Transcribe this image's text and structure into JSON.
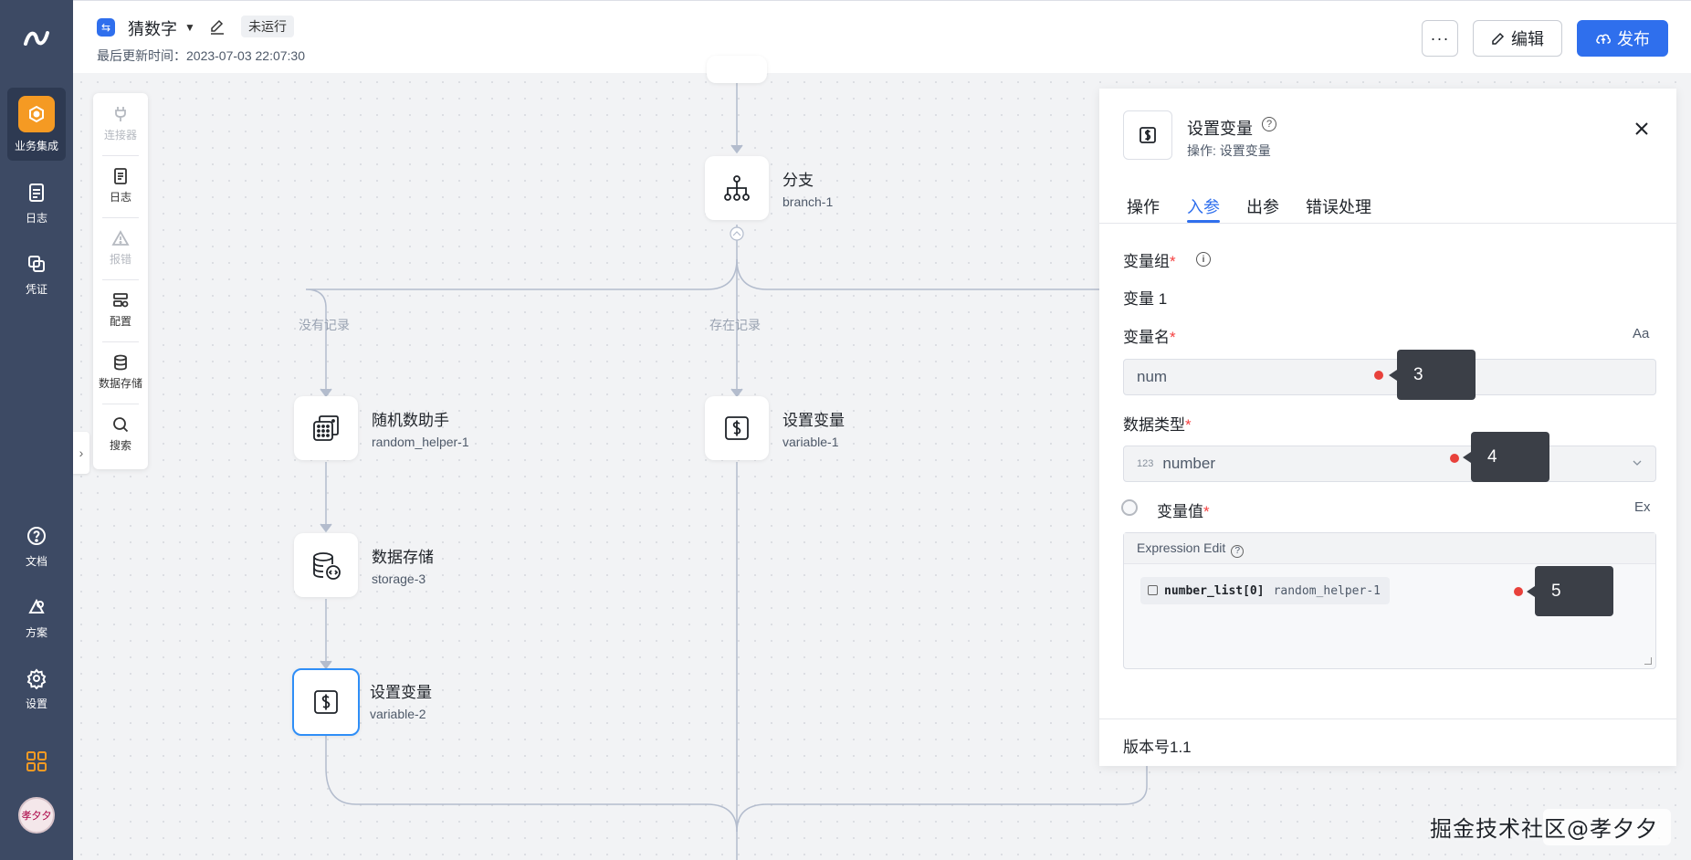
{
  "nav": {
    "items": [
      {
        "label": "业务集成",
        "icon": "integration-icon",
        "active": true
      },
      {
        "label": "日志",
        "icon": "log-icon"
      },
      {
        "label": "凭证",
        "icon": "credential-icon"
      },
      {
        "label": "文档",
        "icon": "help-icon"
      },
      {
        "label": "方案",
        "icon": "solution-icon"
      },
      {
        "label": "设置",
        "icon": "gear-icon"
      }
    ],
    "avatar_text": "孝夕夕"
  },
  "header": {
    "workflow_title": "猜数字",
    "status": "未运行",
    "updated_label": "最后更新时间：2023-07-03 22:07:30",
    "more_label": "···",
    "edit_label": "编辑",
    "publish_label": "发布"
  },
  "tools": [
    {
      "label": "连接器",
      "disabled": true
    },
    {
      "label": "日志",
      "disabled": false
    },
    {
      "label": "报错",
      "disabled": true
    },
    {
      "label": "配置",
      "disabled": false
    },
    {
      "label": "数据存储",
      "disabled": false
    },
    {
      "label": "搜索",
      "disabled": false
    }
  ],
  "flow": {
    "nodes": {
      "branch": {
        "title": "分支",
        "id": "branch-1"
      },
      "random": {
        "title": "随机数助手",
        "id": "random_helper-1"
      },
      "var1": {
        "title": "设置变量",
        "id": "variable-1"
      },
      "storage": {
        "title": "数据存储",
        "id": "storage-3"
      },
      "var2": {
        "title": "设置变量",
        "id": "variable-2"
      }
    },
    "edge_labels": {
      "left": "没有记录",
      "middle": "存在记录"
    }
  },
  "panel": {
    "title": "设置变量",
    "subtitle": "操作: 设置变量",
    "tabs": [
      "操作",
      "入参",
      "出参",
      "错误处理"
    ],
    "active_tab": "入参",
    "group_label": "变量组",
    "group_item": "变量 1",
    "name_label": "变量名",
    "name_value": "num",
    "name_tag": "Aa",
    "type_label": "数据类型",
    "type_prefix": "123",
    "type_value": "number",
    "value_label": "变量值",
    "value_tag": "Ex",
    "expr_header": "Expression Edit",
    "expr_token_main": "number_list[0]",
    "expr_token_source": "random_helper-1",
    "version": "版本号1.1"
  },
  "callouts": [
    "3",
    "4",
    "5"
  ],
  "watermark": "掘金技术社区@孝夕夕",
  "colors": {
    "nav_bg": "#3d4a64",
    "accent": "#2f6fed",
    "callout_bg": "#3b3f47",
    "marker": "#e8413b"
  }
}
